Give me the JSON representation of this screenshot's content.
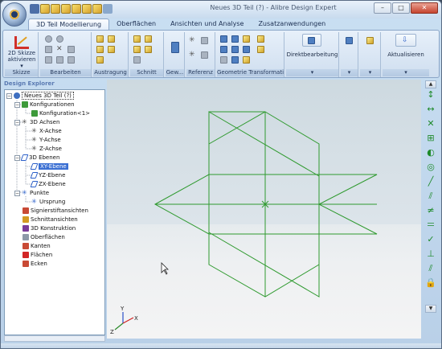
{
  "window": {
    "title": "Neues 3D Teil (?) - Alibre Design Expert",
    "controls": {
      "minimize": "–",
      "maximize": "□",
      "close": "✕"
    }
  },
  "quick_access": [
    "save-icon",
    "cube-icon",
    "cube-icon",
    "cube-icon",
    "cube-icon",
    "cube-icon",
    "cube-icon",
    "undo-icon"
  ],
  "ribbon": {
    "tabs": [
      {
        "label": "3D Teil Modellierung",
        "active": true
      },
      {
        "label": "Oberflächen",
        "active": false
      },
      {
        "label": "Ansichten und Analyse",
        "active": false
      },
      {
        "label": "Zusatzanwendungen",
        "active": false
      }
    ],
    "groups": {
      "skizze": {
        "label": "Skizze",
        "button_line1": "2D Skizze",
        "button_line2": "aktivieren ▾"
      },
      "bearbeiten": {
        "label": "Bearbeiten"
      },
      "austragung": {
        "label": "Austragung"
      },
      "schnitt": {
        "label": "Schnitt"
      },
      "gew": {
        "label": "Gew..."
      },
      "referenz": {
        "label": "Referenz"
      },
      "geometrie": {
        "label": "Geometrie Transformati..."
      },
      "direkt": {
        "label": "Direktbearbeitung"
      },
      "aktualisieren": {
        "label": "Aktualisieren"
      }
    }
  },
  "explorer": {
    "title": "Design Explorer",
    "root": "Neues 3D Teil (?)",
    "nodes": {
      "konfigurationen": "Konfigurationen",
      "konfiguration1": "Konfiguration<1>",
      "achsen": "3D Achsen",
      "x_achse": "X-Achse",
      "y_achse": "Y-Achse",
      "z_achse": "Z-Achse",
      "ebenen": "3D Ebenen",
      "xy_ebene": "XY-Ebene",
      "yz_ebene": "YZ-Ebene",
      "zx_ebene": "ZX-Ebene",
      "punkte": "Punkte",
      "ursprung": "Ursprung",
      "signierstift": "Signierstiftansichten",
      "schnittansichten": "Schnittansichten",
      "konstruktion": "3D Konstruktion",
      "oberflaechen": "Oberflächen",
      "kanten": "Kanten",
      "flaechen": "Flächen",
      "ecken": "Ecken"
    }
  },
  "viewport": {
    "axis_labels": {
      "x": "X",
      "y": "Y",
      "z": "Z"
    },
    "plane_color": "#2f9a2f",
    "axis_colors": {
      "x": "#d02020",
      "y": "#2a4fc8",
      "z": "#2a8a2a"
    }
  },
  "right_toolbar": [
    "vertical-constraint-icon",
    "horizontal-constraint-icon",
    "intersect-icon",
    "midpoint-icon",
    "tangent-icon",
    "concentric-icon",
    "collinear-icon",
    "parallel-icon",
    "equal-icon",
    "perpendicular-icon",
    "coincident-icon",
    "fix-icon",
    "symmetry-icon",
    "lock-icon"
  ]
}
